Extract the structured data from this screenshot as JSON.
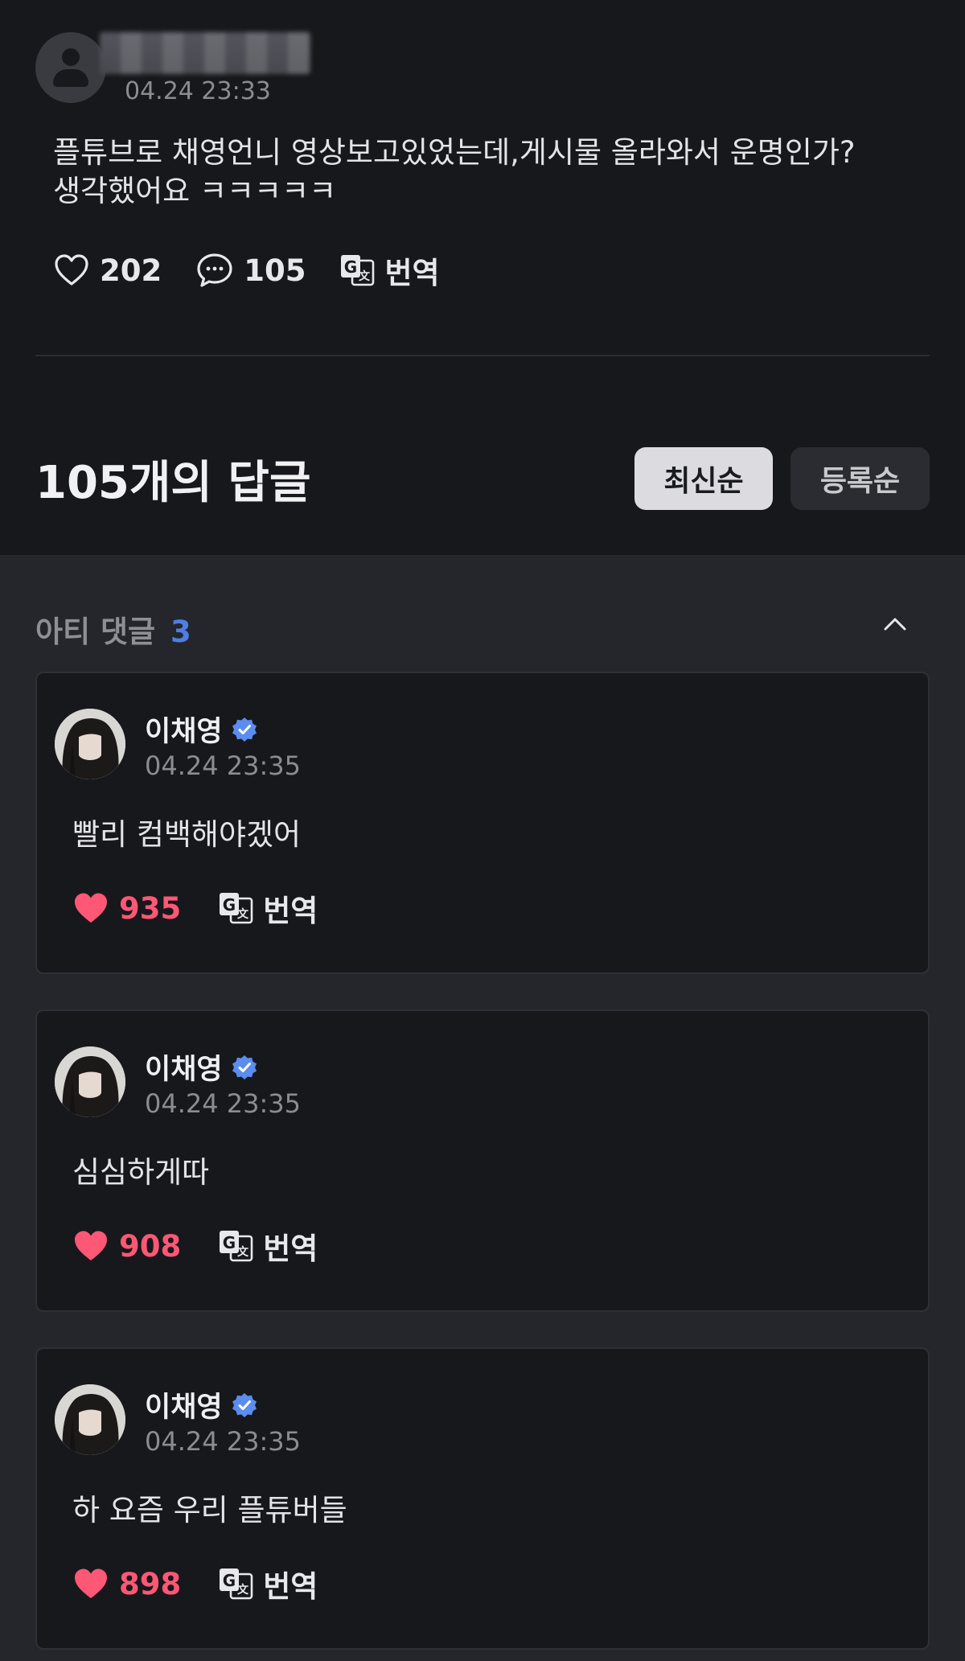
{
  "post": {
    "time": "04.24 23:33",
    "body": "플튜브로 채영언니 영상보고있었는데,게시물 올라와서 운명인가?\n생각했어요 ㅋㅋㅋㅋㅋ",
    "likes": "202",
    "comments": "105",
    "translate_label": "번역"
  },
  "replies": {
    "title": "105개의 답글",
    "sort_latest": "최신순",
    "sort_registered": "등록순"
  },
  "artist_comments": {
    "label": "아티 댓글",
    "count": "3",
    "items": [
      {
        "name": "이채영",
        "time": "04.24 23:35",
        "text": "빨리 컴백해야겠어",
        "likes": "935",
        "translate_label": "번역"
      },
      {
        "name": "이채영",
        "time": "04.24 23:35",
        "text": "심심하게따",
        "likes": "908",
        "translate_label": "번역"
      },
      {
        "name": "이채영",
        "time": "04.24 23:35",
        "text": "하 요즘 우리 플튜버들",
        "likes": "898",
        "translate_label": "번역"
      }
    ]
  },
  "colors": {
    "background": "#17181c",
    "section_background": "#25262b",
    "like_active": "#ff5775",
    "count_accent": "#4f7ee5",
    "verified": "#5b8def"
  },
  "icons": {
    "heart_outline": "heart-outline-icon",
    "heart_filled": "heart-filled-icon",
    "comment": "comment-bubble-icon",
    "translate": "translate-icon",
    "verified": "verified-badge-icon",
    "chevron": "chevron-up-icon"
  }
}
